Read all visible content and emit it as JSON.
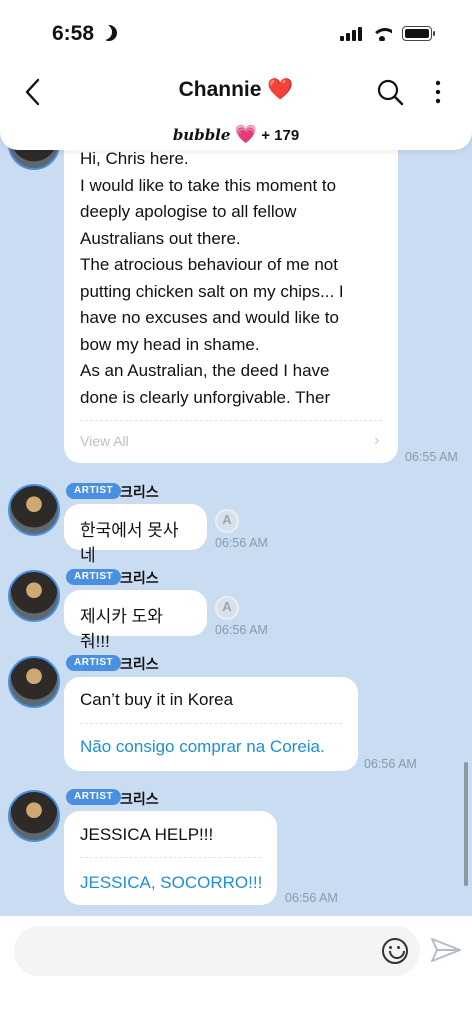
{
  "status_bar": {
    "time": "6:58"
  },
  "header": {
    "title": "Channie",
    "title_emoji": "❤️",
    "subline_brand": "bubble",
    "subline_heart": "💗",
    "subline_count": "+ 179"
  },
  "messages": [
    {
      "kind": "long",
      "lines": [
        "Hi, Chris here.",
        "I would like to take this moment to",
        "deeply apologise to all fellow",
        "Australians out there.",
        "The atrocious behaviour of me not",
        "putting chicken salt on my chips... I",
        "have no excuses and would like to",
        "bow my head in shame.",
        "As an Australian, the deed I have",
        "done is clearly unforgivable. Ther"
      ],
      "view_all": "View All",
      "time": "06:55 AM"
    },
    {
      "tag": "ARTIST",
      "sender": "크리스",
      "text": "한국에서 못사네",
      "time": "06:56 AM"
    },
    {
      "tag": "ARTIST",
      "sender": "크리스",
      "text": "제시카 도와줘!!!",
      "time": "06:56 AM"
    },
    {
      "tag": "ARTIST",
      "sender": "크리스",
      "text": "Can’t buy it in Korea",
      "translation": "Não consigo comprar na Coreia.",
      "time": "06:56 AM"
    },
    {
      "tag": "ARTIST",
      "sender": "크리스",
      "text": "JESSICA HELP!!!",
      "translation": "JESSICA, SOCORRO!!!",
      "time": "06:56 AM"
    }
  ],
  "colors": {
    "chat_bg": "#c9dcf1",
    "accent": "#4a90e2",
    "translation": "#1d8fd8"
  },
  "icons": [
    "back-chevron-icon",
    "search-icon",
    "more-vertical-icon",
    "translate-icon",
    "emoji-icon",
    "send-icon"
  ]
}
